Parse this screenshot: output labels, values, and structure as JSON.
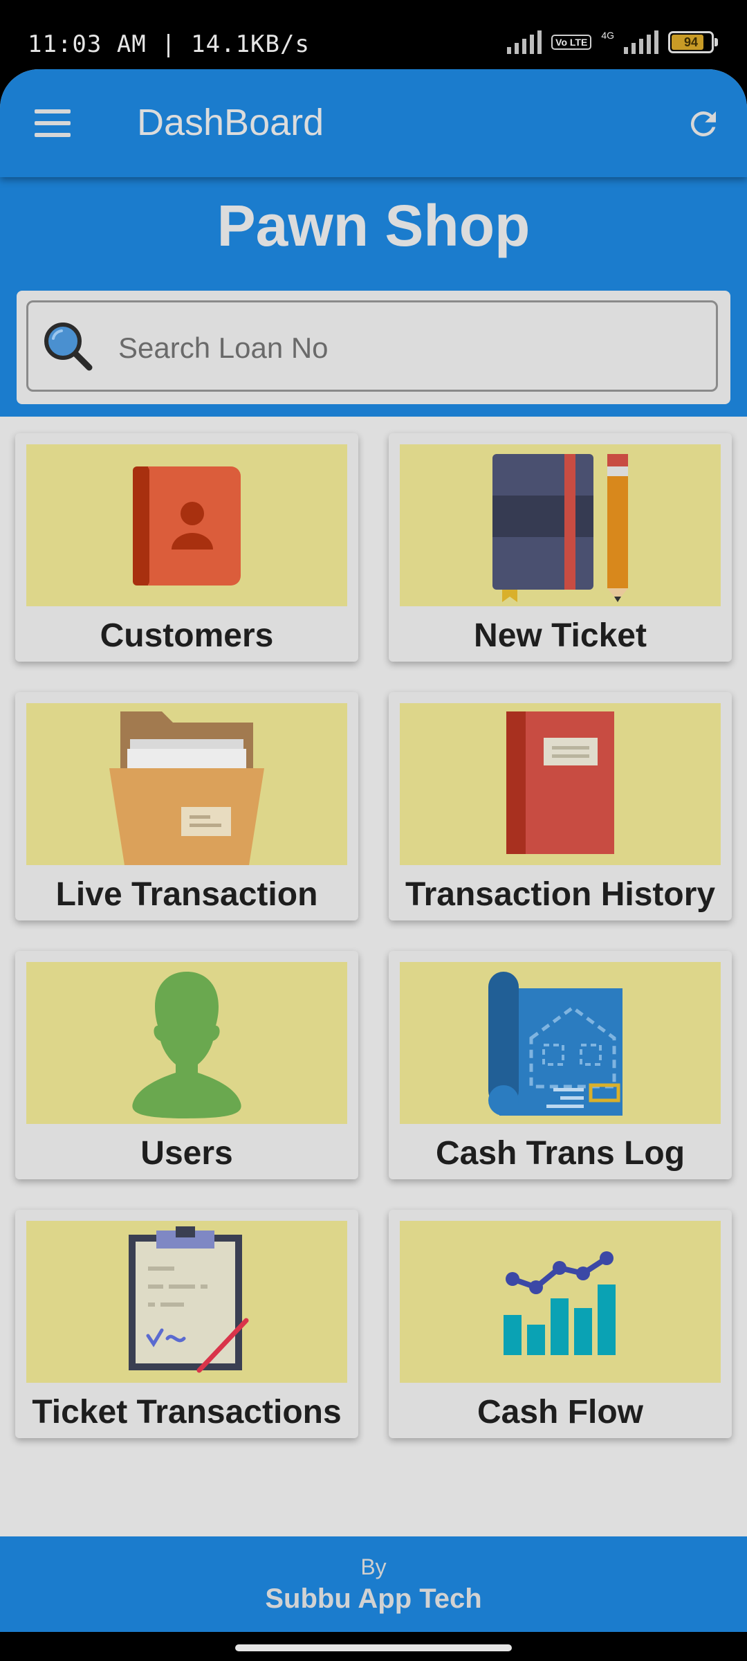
{
  "status_bar": {
    "time_speed": "11:03 AM | 14.1KB/s",
    "volte": "Vo LTE",
    "network": "4G",
    "battery": "94"
  },
  "appbar": {
    "title": "DashBoard"
  },
  "header": {
    "shop_title": "Pawn Shop"
  },
  "search": {
    "placeholder": "Search Loan No",
    "value": ""
  },
  "tiles": [
    {
      "label": "Customers",
      "icon": "address-book-icon"
    },
    {
      "label": "New Ticket",
      "icon": "notebook-pencil-icon"
    },
    {
      "label": "Live Transaction",
      "icon": "file-folder-icon"
    },
    {
      "label": "Transaction History",
      "icon": "red-book-icon"
    },
    {
      "label": "Users",
      "icon": "user-silhouette-icon"
    },
    {
      "label": "Cash Trans Log",
      "icon": "blueprint-icon"
    },
    {
      "label": "Ticket Transactions",
      "icon": "clipboard-icon"
    },
    {
      "label": "Cash Flow",
      "icon": "bar-line-chart-icon"
    }
  ],
  "footer": {
    "by": "By",
    "brand": "Subbu App Tech"
  },
  "colors": {
    "primary": "#1b7ccd",
    "tile_bg": "#ddd68a",
    "surface": "#dedede"
  }
}
